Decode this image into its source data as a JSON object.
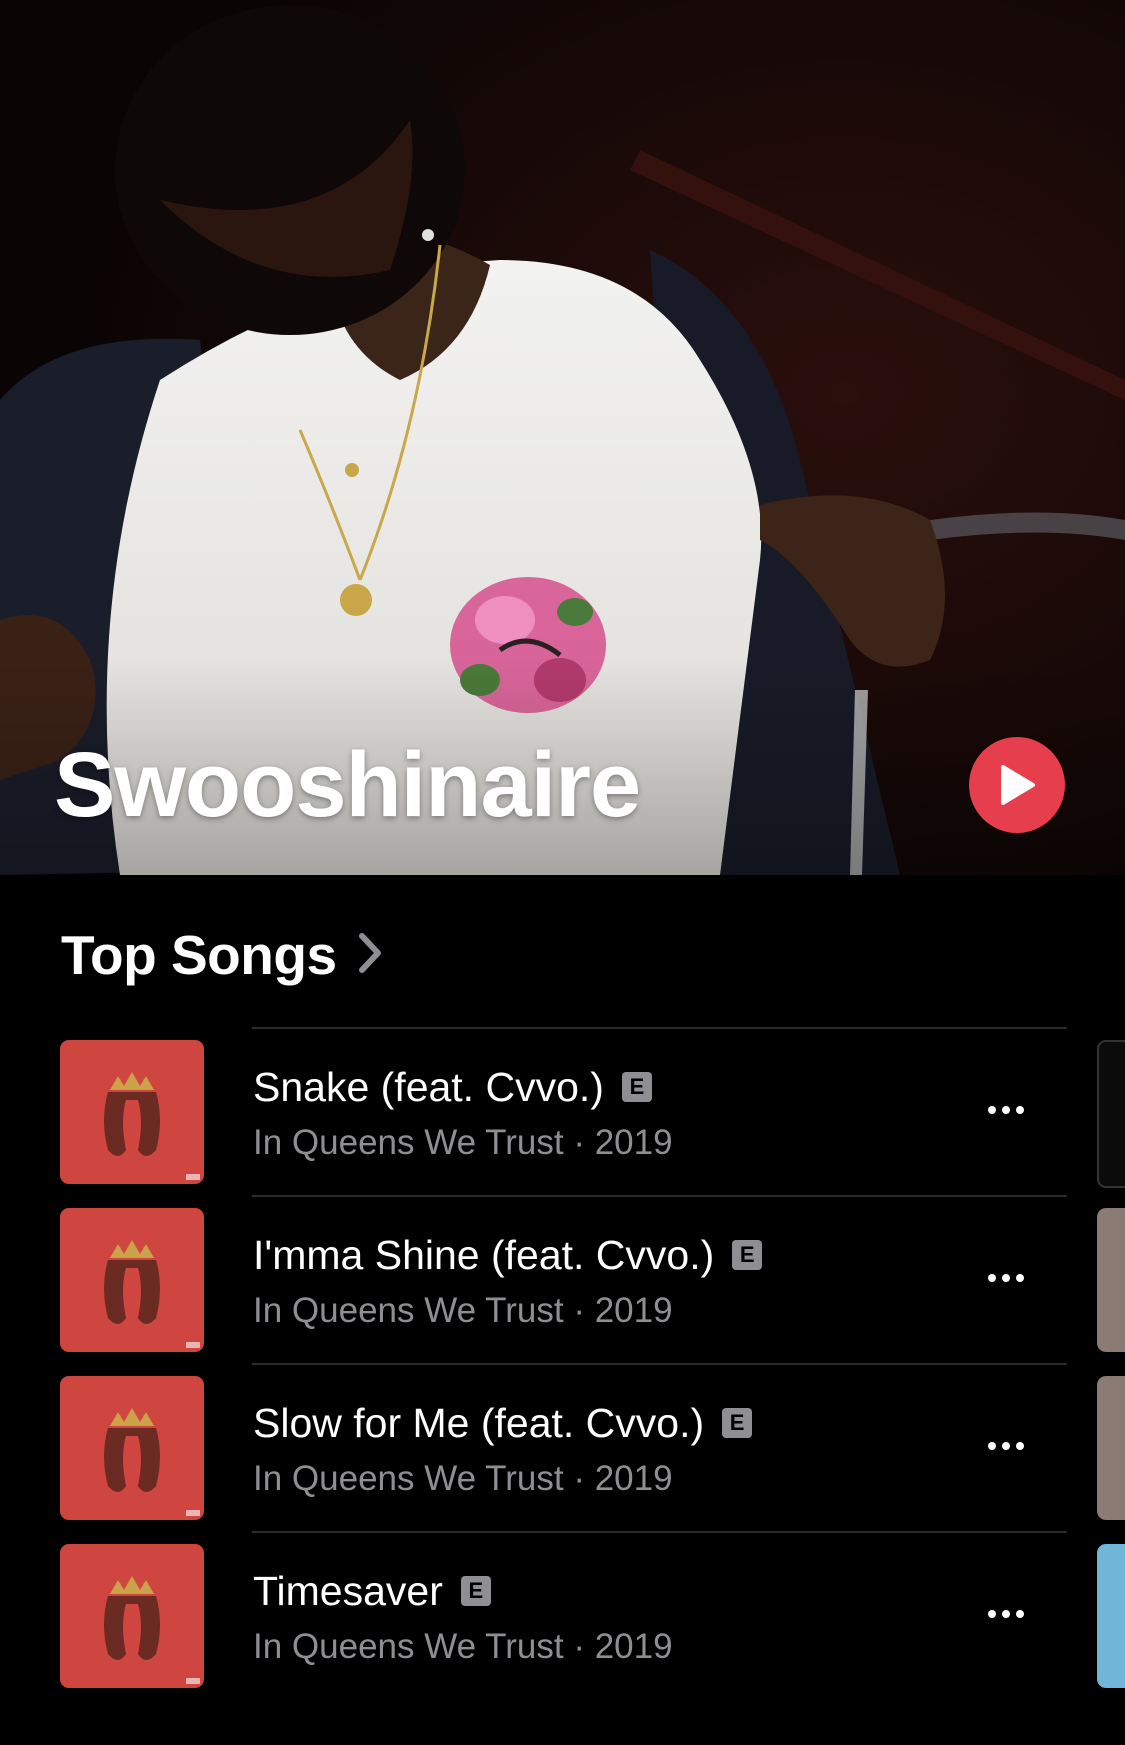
{
  "artist": {
    "name": "Swooshinaire",
    "play_icon": "play-icon",
    "accent_color": "#e63e4d"
  },
  "top_songs": {
    "title": "Top Songs",
    "chevron_icon": "chevron-right-icon",
    "songs": [
      {
        "title": "Snake (feat. Cvvo.)",
        "explicit": "E",
        "album": "In Queens We Trust",
        "year": "2019",
        "subtitle": "In Queens We Trust · 2019",
        "more_icon": "ellipsis-icon"
      },
      {
        "title": "I'mma Shine (feat. Cvvo.)",
        "explicit": "E",
        "album": "In Queens We Trust",
        "year": "2019",
        "subtitle": "In Queens We Trust · 2019",
        "more_icon": "ellipsis-icon"
      },
      {
        "title": "Slow for Me (feat. Cvvo.)",
        "explicit": "E",
        "album": "In Queens We Trust",
        "year": "2019",
        "subtitle": "In Queens We Trust · 2019",
        "more_icon": "ellipsis-icon"
      },
      {
        "title": "Timesaver",
        "explicit": "E",
        "album": "In Queens We Trust",
        "year": "2019",
        "subtitle": "In Queens We Trust · 2019",
        "more_icon": "ellipsis-icon"
      }
    ]
  }
}
